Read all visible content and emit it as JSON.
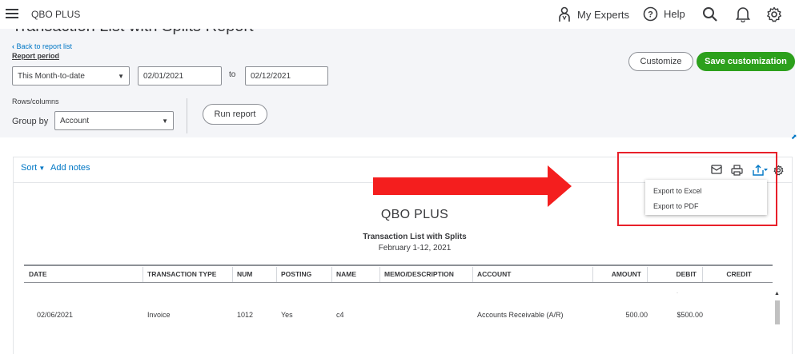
{
  "app": {
    "company": "QBO PLUS"
  },
  "nav": {
    "experts_label": "My Experts",
    "help_label": "Help"
  },
  "header": {
    "page_title": "Transaction List with Splits Report",
    "back_link": "Back to report list",
    "period_label": "Report period",
    "period_select": "This Month-to-date",
    "date_from": "02/01/2021",
    "to_label": "to",
    "date_to": "02/12/2021",
    "rows_columns_label": "Rows/columns",
    "group_by_label": "Group by",
    "group_by_value": "Account",
    "run_report": "Run report",
    "customize": "Customize",
    "save_customization": "Save customization"
  },
  "toolbar": {
    "sort_label": "Sort",
    "add_notes_label": "Add notes",
    "export_menu": [
      "Export to Excel",
      "Export to PDF"
    ]
  },
  "report": {
    "company": "QBO PLUS",
    "title": "Transaction List with Splits",
    "date_range": "February 1-12, 2021",
    "columns": [
      "DATE",
      "TRANSACTION TYPE",
      "NUM",
      "POSTING",
      "NAME",
      "MEMO/DESCRIPTION",
      "ACCOUNT",
      "AMOUNT",
      "DEBIT",
      "CREDIT"
    ],
    "rows": [
      [
        "02/06/2021",
        "Invoice",
        "1012",
        "Yes",
        "c4",
        "",
        "Accounts Receivable (A/R)",
        "500.00",
        "$500.00",
        ""
      ]
    ]
  },
  "colors": {
    "accent_blue": "#0077c5",
    "brand_green": "#2ca01c",
    "highlight_red": "#e8202a"
  }
}
